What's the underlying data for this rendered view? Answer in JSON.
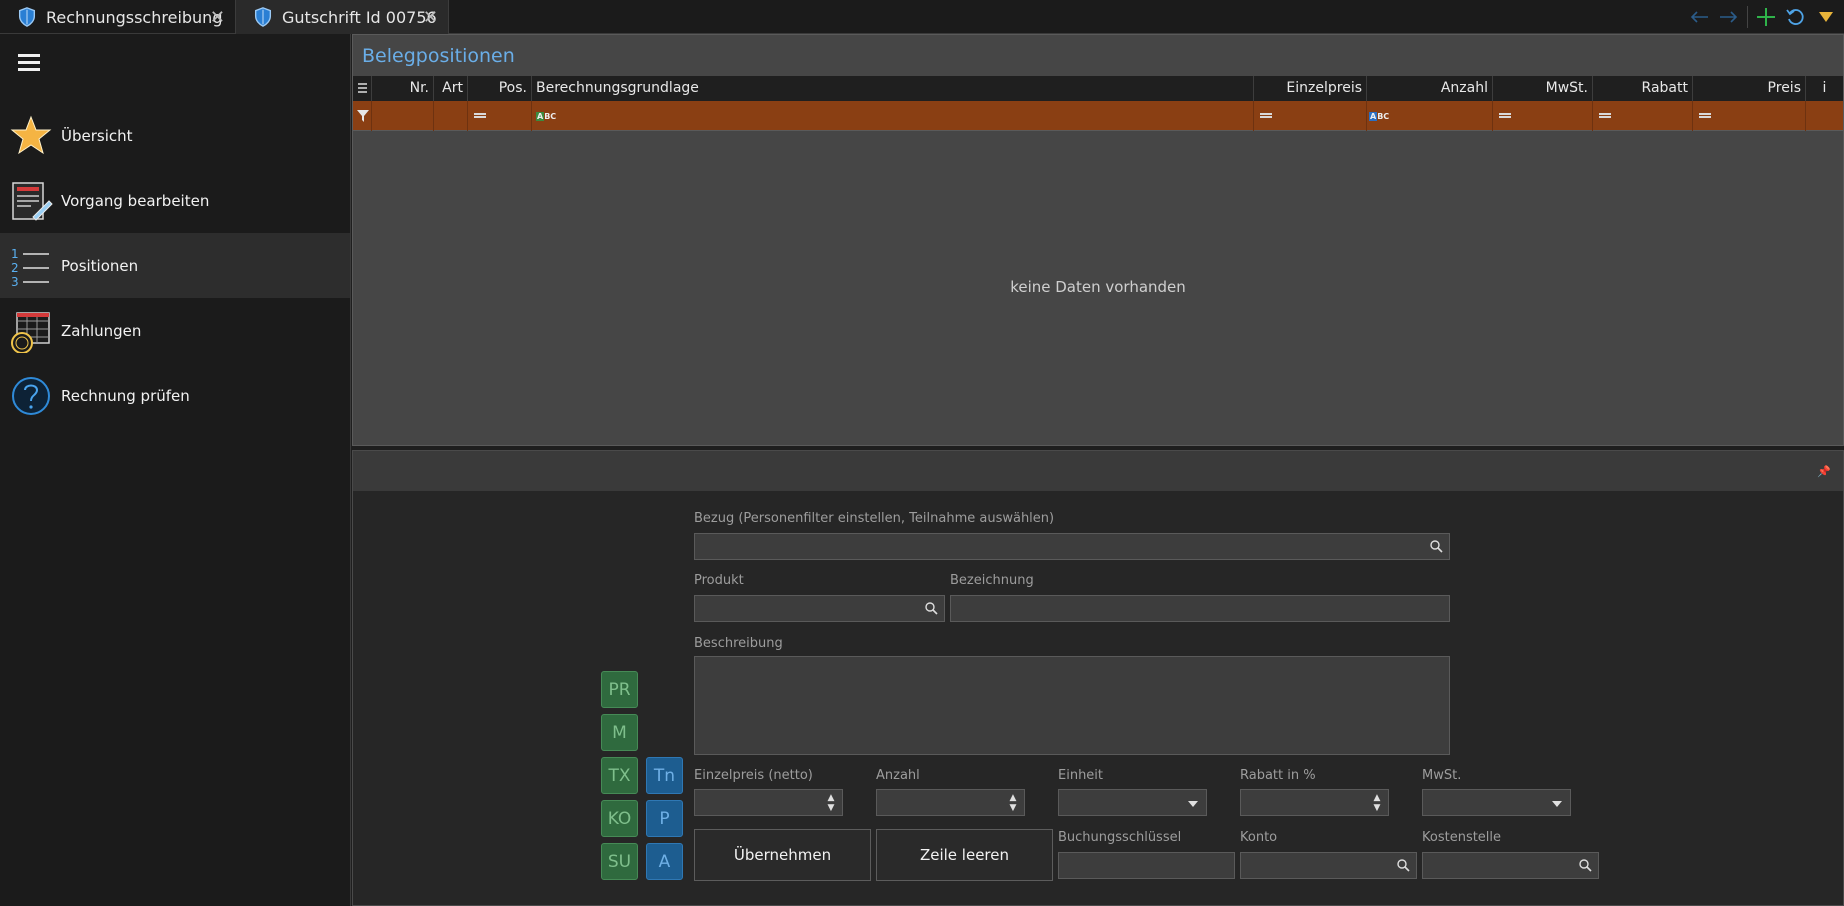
{
  "tabs": [
    {
      "label": "Rechnungsschreibung",
      "icon": "shield-icon"
    },
    {
      "label": "Gutschrift Id 00756",
      "icon": "shield-icon"
    }
  ],
  "toolbar_icons": [
    "back-arrow-icon",
    "forward-arrow-icon",
    "plus-icon",
    "refresh-icon",
    "dropdown-triangle-icon"
  ],
  "sidebar": {
    "items": [
      {
        "label": "Übersicht",
        "icon": "star-icon"
      },
      {
        "label": "Vorgang bearbeiten",
        "icon": "edit-document-icon"
      },
      {
        "label": "Positionen",
        "icon": "numbered-list-icon"
      },
      {
        "label": "Zahlungen",
        "icon": "payment-table-icon"
      },
      {
        "label": "Rechnung prüfen",
        "icon": "question-icon"
      }
    ],
    "active_index": 2
  },
  "grid": {
    "title": "Belegpositionen",
    "columns": {
      "nr": "Nr.",
      "art": "Art",
      "pos": "Pos.",
      "berechnungsgrundlage": "Berechnungsgrundlage",
      "einzelpreis": "Einzelpreis",
      "anzahl": "Anzahl",
      "mwst": "MwSt.",
      "rabatt": "Rabatt",
      "preis": "Preis",
      "info": "i"
    },
    "empty_message": "keine Daten vorhanden"
  },
  "editor": {
    "bezug_label": "Bezug (Personenfilter einstellen, Teilnahme auswählen)",
    "produkt_label": "Produkt",
    "bezeichnung_label": "Bezeichnung",
    "beschreibung_label": "Beschreibung",
    "einzelpreis_label": "Einzelpreis (netto)",
    "anzahl_label": "Anzahl",
    "einheit_label": "Einheit",
    "rabatt_label": "Rabatt in %",
    "mwst_label": "MwSt.",
    "buchungsschluessel_label": "Buchungsschlüssel",
    "konto_label": "Konto",
    "kostenstelle_label": "Kostenstelle",
    "uebernehmen_label": "Übernehmen",
    "zeile_leeren_label": "Zeile leeren",
    "quick_buttons_green": [
      "PR",
      "M",
      "TX",
      "KO",
      "SU"
    ],
    "quick_buttons_blue": [
      "Tn",
      "P",
      "A"
    ]
  },
  "colors": {
    "accent_blue": "#6aaee8",
    "filter_row": "#8a3f13",
    "quick_green": "#2f6a3e",
    "quick_blue": "#1d5d90"
  }
}
